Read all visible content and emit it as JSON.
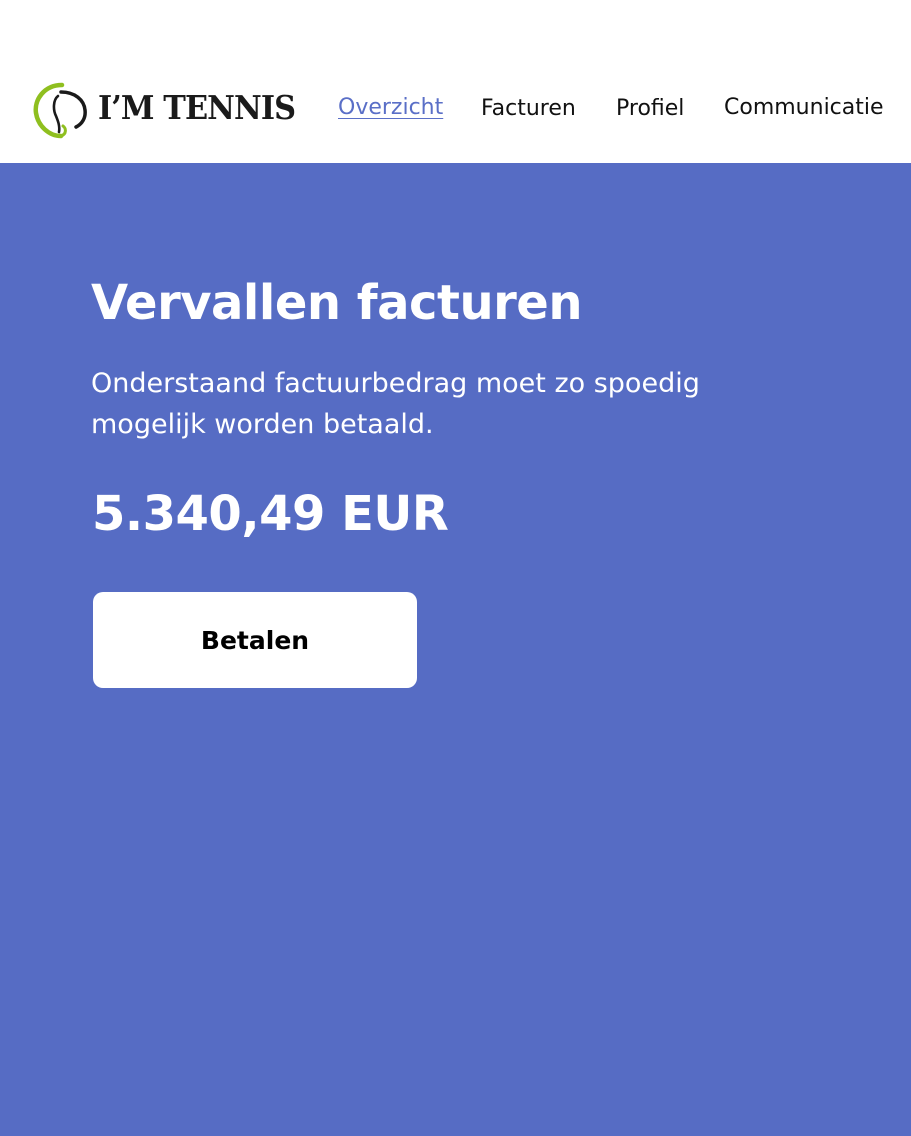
{
  "brand": {
    "name": "I’M TENNIS",
    "icon": "tennis-swoosh-icon",
    "colors": {
      "swoosh_green": "#8fbf1f",
      "swoosh_dark": "#1a1a1a"
    }
  },
  "nav": {
    "items": [
      {
        "label": "Overzicht",
        "active": true
      },
      {
        "label": "Facturen",
        "active": false
      },
      {
        "label": "Profiel",
        "active": false
      },
      {
        "label": "Communicatie",
        "active": false
      }
    ]
  },
  "hero": {
    "title": "Vervallen facturen",
    "description": "Onderstaand factuurbedrag moet zo spoedig mogelijk worden betaald.",
    "amount": "5.340,49 EUR",
    "pay_button_label": "Betalen"
  },
  "theme": {
    "hero_background": "#566cc4",
    "active_link": "#5a6fc7",
    "text_on_hero": "#ffffff"
  }
}
